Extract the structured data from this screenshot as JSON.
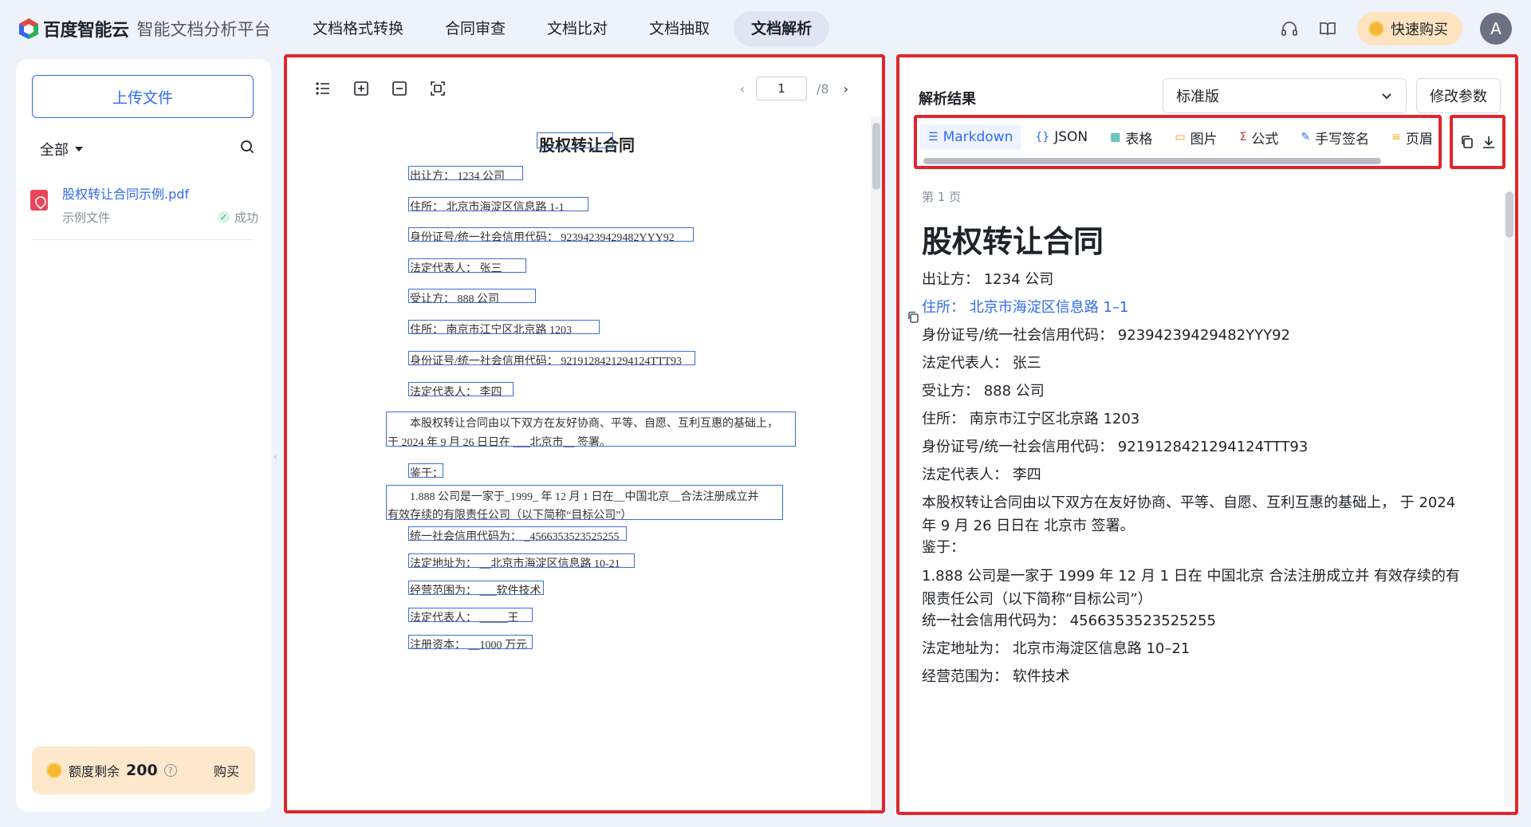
{
  "header": {
    "brand": "百度智能云",
    "subtitle": "智能文档分析平台",
    "nav": [
      "文档格式转换",
      "合同审查",
      "文档比对",
      "文档抽取",
      "文档解析"
    ],
    "active_nav": "文档解析",
    "buy_label": "快速购买",
    "avatar": "A",
    "icons": [
      "headset-icon",
      "book-icon"
    ]
  },
  "sidebar": {
    "upload_label": "上传文件",
    "filter_label": "全部",
    "file": {
      "name": "股权转让合同示例.pdf",
      "meta": "示例文件",
      "status": "成功"
    },
    "quota_label": "额度剩余",
    "quota_value": "200",
    "quota_buy": "购买"
  },
  "viewer": {
    "page_current": "1",
    "page_total": "/8",
    "doc": {
      "title": "股权转让合同",
      "l1": "出让方：      1234 公司",
      "l2": "住所：      北京市海淀区信息路 1-1",
      "l3": "身份证号/统一社会信用代码：    92394239429482YYY92",
      "l4": "法定代表人：        张三",
      "l5": "受让方：            888 公司",
      "l6": "住所：        南京市江宁区北京路 1203",
      "l7": "身份证号/统一社会信用代码：   9219128421294124TTT93",
      "l8": "法定代表人：      李四",
      "p1a": "本股权转让合同由以下双方在友好协商、平等、自愿、互利互惠的基础上，",
      "p1b": "于 2024 年 9 月 26 日日在 ___北京市__ 签署。",
      "l9": "鉴于：",
      "p2a": "1.888 公司是一家于_1999_ 年 12 月 1 日在__中国北京__合法注册成立并",
      "p2b": "有效存续的有限责任公司（以下简称“目标公司”）",
      "l10": "统一社会信用代码为： _4566353523525255",
      "l11": "法定地址为： __北京市海淀区信息路 10-21",
      "l12": "经营范围为： ___软件技术",
      "l13": "法定代表人：  _____王",
      "l14": "注册资本：  __1000 万元"
    }
  },
  "result": {
    "title": "解析结果",
    "version": "标准版",
    "param_btn": "修改参数",
    "tabs": [
      {
        "icon": "☰",
        "label": "Markdown"
      },
      {
        "icon": "{}",
        "label": "JSON"
      },
      {
        "icon": "▦",
        "label": "表格"
      },
      {
        "icon": "▭",
        "label": "图片"
      },
      {
        "icon": "Σ",
        "label": "公式"
      },
      {
        "icon": "✎",
        "label": "手写签名"
      },
      {
        "icon": "≡",
        "label": "页眉"
      }
    ],
    "page_no": "第 1 页",
    "h1": "股权转让合同",
    "lines": [
      "出让方：  1234 公司",
      "住所：  北京市海淀区信息路 1–1",
      "身份证号/统一社会信用代码：  92394239429482YYY92",
      "法定代表人：  张三",
      "受让方：  888 公司",
      "住所：  南京市江宁区北京路 1203",
      "身份证号/统一社会信用代码：  9219128421294124TTT93",
      "法定代表人：  李四",
      "本股权转让合同由以下双方在友好协商、平等、自愿、互利互惠的基础上， 于 2024 年 9 月 26 日日在 北京市 签署。",
      "鉴于：",
      "1.888 公司是一家于 1999 年 12 月 1 日在 中国北京 合法注册成立并 有效存续的有限责任公司（以下简称“目标公司”）",
      "统一社会信用代码为：  4566353523525255",
      "法定地址为：  北京市海淀区信息路 10–21",
      "经营范围为：  软件技术"
    ]
  }
}
